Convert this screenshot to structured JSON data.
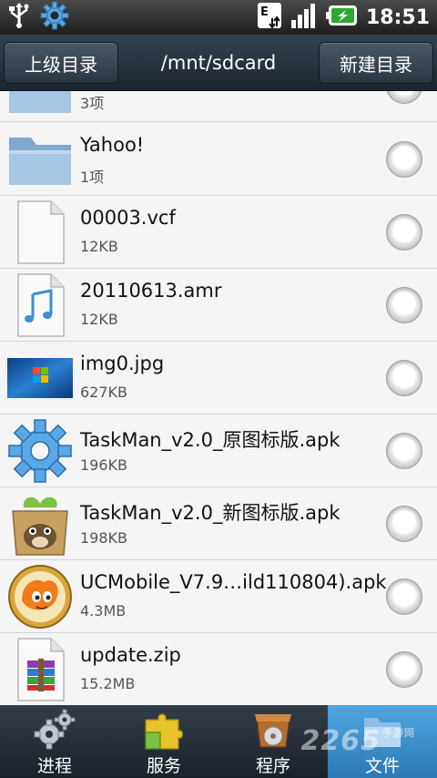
{
  "status_bar": {
    "time": "18:51",
    "icons": [
      "usb-icon",
      "gear-icon",
      "network-e-icon",
      "signal-icon",
      "battery-charging-icon"
    ]
  },
  "header": {
    "up_button": "上级目录",
    "path": "/mnt/sdcard",
    "new_folder_button": "新建目录"
  },
  "files": [
    {
      "name": "",
      "meta": "3项",
      "icon": "folder-icon"
    },
    {
      "name": "Yahoo!",
      "meta": "1项",
      "icon": "folder-icon"
    },
    {
      "name": "00003.vcf",
      "meta": "12KB",
      "icon": "document-icon"
    },
    {
      "name": "20110613.amr",
      "meta": "12KB",
      "icon": "music-file-icon"
    },
    {
      "name": "img0.jpg",
      "meta": "627KB",
      "icon": "image-thumbnail-icon"
    },
    {
      "name": "TaskMan_v2.0_原图标版.apk",
      "meta": "196KB",
      "icon": "gear-app-icon"
    },
    {
      "name": "TaskMan_v2.0_新图标版.apk",
      "meta": "198KB",
      "icon": "totoro-app-icon"
    },
    {
      "name": "UCMobile_V7.9…ild110804).apk",
      "meta": "4.3MB",
      "icon": "ucbrowser-app-icon"
    },
    {
      "name": "update.zip",
      "meta": "15.2MB",
      "icon": "zip-archive-icon"
    }
  ],
  "tabs": [
    {
      "label": "进程",
      "icon": "gears-icon"
    },
    {
      "label": "服务",
      "icon": "puzzle-icon"
    },
    {
      "label": "程序",
      "icon": "package-box-icon"
    },
    {
      "label": "文件",
      "icon": "folder-tab-icon"
    }
  ],
  "watermark": {
    "text": "2265",
    "sub": "手游网"
  },
  "colors": {
    "active_tab": "#3a8fcf",
    "header_bg": "#26323e",
    "list_bg": "#f5f5f5"
  }
}
